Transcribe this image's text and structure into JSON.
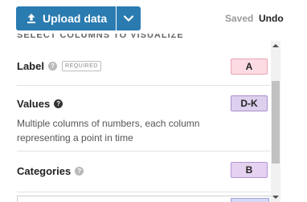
{
  "toolbar": {
    "upload_label": "Upload data",
    "upload_icon": "upload-icon",
    "dropdown_icon": "chevron-down-icon",
    "status": "Saved",
    "undo_label": "Undo",
    "accent_color": "#2a7bb0"
  },
  "section": {
    "title": "Select columns to visualize"
  },
  "fields": {
    "label": {
      "name": "Label",
      "required": "REQUIRED",
      "column": "A",
      "help_icon": "question-icon",
      "color": "#fddbe3"
    },
    "values": {
      "name": "Values",
      "description": "Multiple columns of numbers, each column representing a point in time",
      "column": "D-K",
      "help_icon": "question-icon",
      "color": "#ddd0ee"
    },
    "categories": {
      "name": "Categories",
      "column": "B",
      "help_icon": "question-icon",
      "color": "#e4d2f0"
    }
  }
}
